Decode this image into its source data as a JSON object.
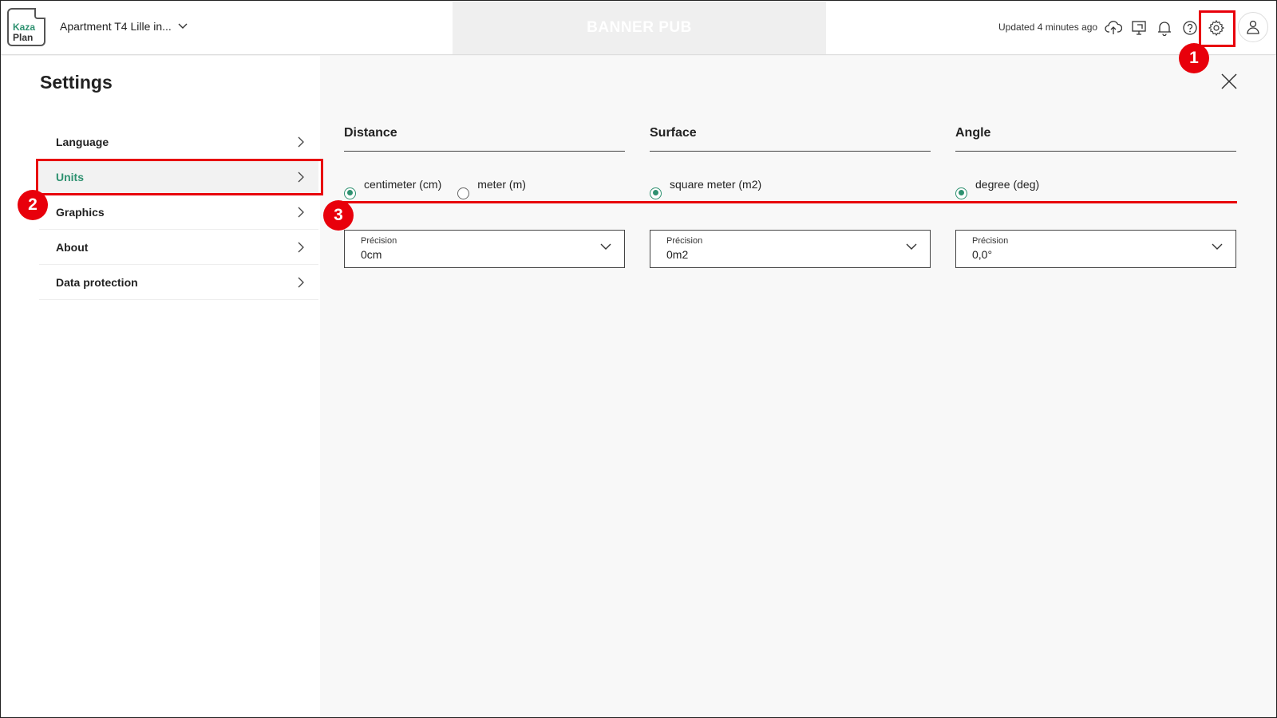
{
  "header": {
    "logo": {
      "line1": "Kaza",
      "line2": "Plan"
    },
    "project_name": "Apartment T4 Lille in...",
    "banner": "BANNER PUB",
    "updated": "Updated 4 minutes ago",
    "icons": [
      "cloud-upload-icon",
      "monitor-icon",
      "bell-icon",
      "help-icon",
      "gear-icon",
      "user-icon"
    ]
  },
  "settings": {
    "title": "Settings",
    "menu": [
      {
        "label": "Language"
      },
      {
        "label": "Units"
      },
      {
        "label": "Graphics"
      },
      {
        "label": "About"
      },
      {
        "label": "Data protection"
      }
    ],
    "active_item": "Units"
  },
  "units": {
    "distance": {
      "title": "Distance",
      "options": [
        {
          "label": "centimeter (cm)",
          "selected": true
        },
        {
          "label": "meter (m)",
          "selected": false
        }
      ],
      "precision_label": "Précision",
      "precision_value": "0cm"
    },
    "surface": {
      "title": "Surface",
      "options": [
        {
          "label": "square meter (m2)",
          "selected": true
        }
      ],
      "precision_label": "Précision",
      "precision_value": "0m2"
    },
    "angle": {
      "title": "Angle",
      "options": [
        {
          "label": "degree (deg)",
          "selected": true
        }
      ],
      "precision_label": "Précision",
      "precision_value": "0,0°"
    }
  },
  "annotations": {
    "badge1": "1",
    "badge2": "2",
    "badge3": "3"
  },
  "colors": {
    "accent": "#2e9170",
    "annotation": "#e8000b"
  }
}
